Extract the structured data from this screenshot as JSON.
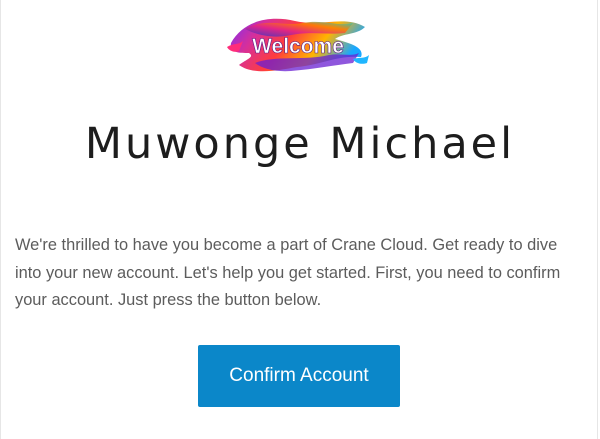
{
  "header": {
    "logo_text": "Welcome",
    "logo_icon": "welcome-paint-splash-icon"
  },
  "main": {
    "name": "Muwonge Michael",
    "message": "We're thrilled to have you become a part of Crane Cloud. Get ready to dive into your new account. Let's help you get started. First, you need to confirm your account. Just press the button below.",
    "confirm_label": "Confirm Account"
  },
  "colors": {
    "button": "#0b87c9",
    "heading": "#1d1d1d",
    "body_text": "#5c5c5c",
    "background": "#ffffff"
  }
}
